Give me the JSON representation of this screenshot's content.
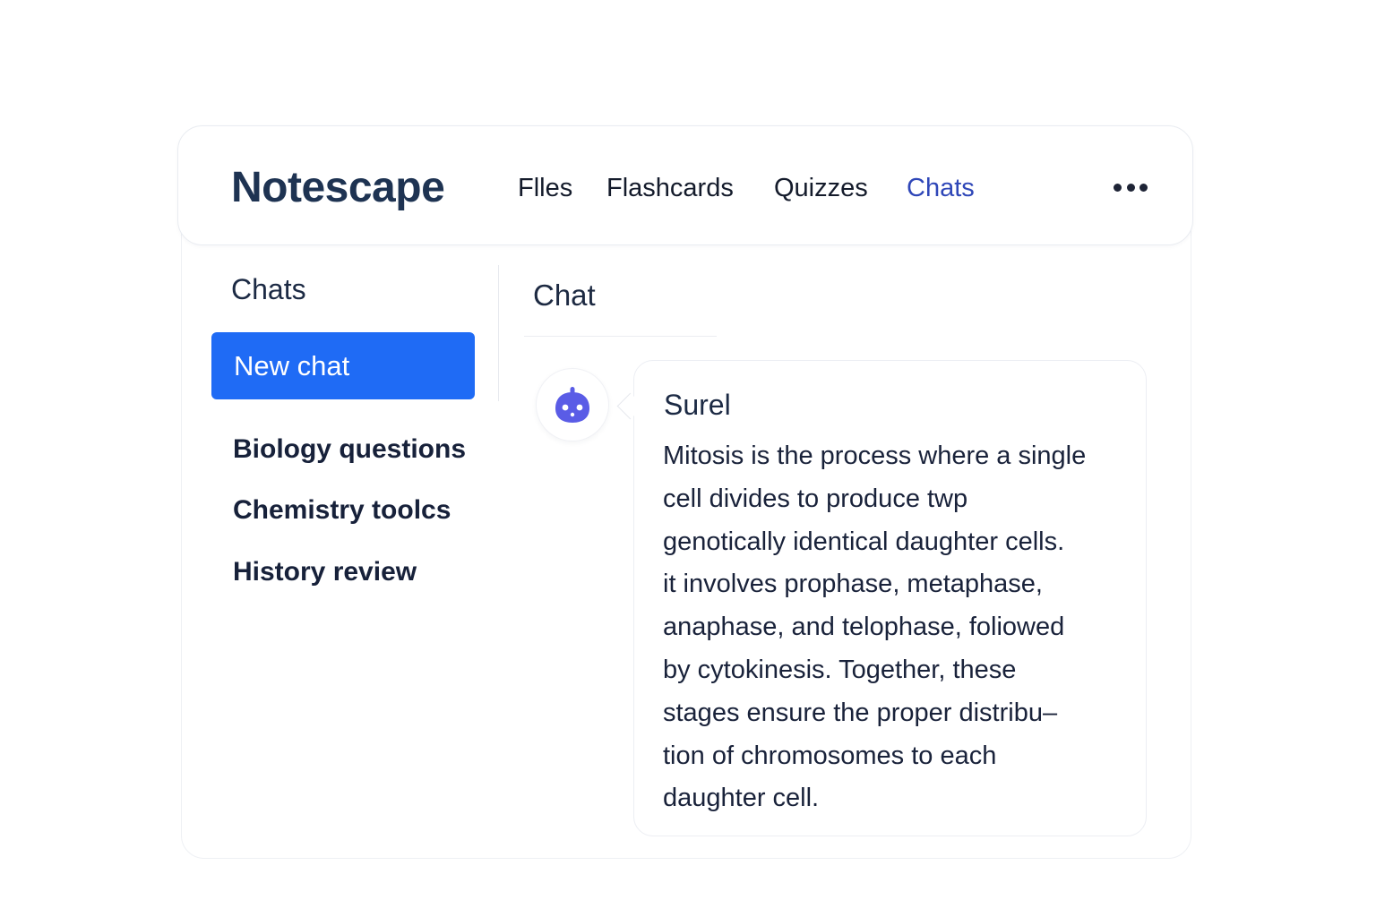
{
  "app": {
    "name": "Notescape"
  },
  "nav": {
    "items": [
      {
        "label": "Flles",
        "active": false
      },
      {
        "label": "Flashcards",
        "active": false
      },
      {
        "label": "Quizzes",
        "active": false
      },
      {
        "label": "Chats",
        "active": true
      }
    ],
    "more_icon": "more-horizontal-icon"
  },
  "sidebar": {
    "title": "Chats",
    "new_chat_label": "New chat",
    "items": [
      {
        "label": "Biology questions"
      },
      {
        "label": "Chemistry toolcs"
      },
      {
        "label": "History review"
      }
    ]
  },
  "chat": {
    "title": "Chat",
    "message": {
      "avatar_icon": "bot-icon",
      "sender": "Surel",
      "lines": [
        "Mitosis is the process where a single",
        "cell divides to produce twp",
        "genotically identical daughter cells.",
        "it involves prophase, metaphase,",
        "anaphase, and telophase, foliowed",
        "by cytokinesis. Together, these",
        "stages ensure the proper distribu–",
        "tion of chromosomes to each",
        "daughter cell."
      ]
    }
  },
  "colors": {
    "accent": "#1f6bf5",
    "nav_active": "#2f47b8",
    "logo": "#1e3352",
    "avatar_icon": "#5a5ce6"
  }
}
